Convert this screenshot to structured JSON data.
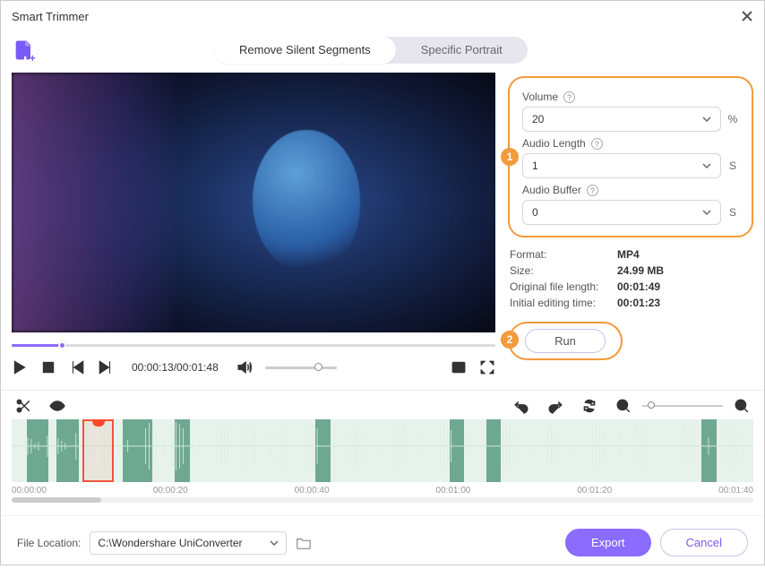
{
  "window": {
    "title": "Smart Trimmer"
  },
  "logo": {
    "name": "app-logo"
  },
  "tabs": [
    {
      "label": "Remove Silent Segments",
      "active": true
    },
    {
      "label": "Specific Portrait",
      "active": false
    }
  ],
  "player": {
    "current_time": "00:00:13",
    "duration": "00:01:48",
    "time_display": "00:00:13/00:01:48"
  },
  "params": {
    "volume": {
      "label": "Volume",
      "value": "20",
      "unit": "%"
    },
    "audio_length": {
      "label": "Audio Length",
      "value": "1",
      "unit": "S"
    },
    "audio_buffer": {
      "label": "Audio Buffer",
      "value": "0",
      "unit": "S"
    }
  },
  "meta": {
    "format": {
      "label": "Format:",
      "value": "MP4"
    },
    "size": {
      "label": "Size:",
      "value": "24.99 MB"
    },
    "orig_len": {
      "label": "Original file length:",
      "value": "00:01:49"
    },
    "init_edit": {
      "label": "Initial editing time:",
      "value": "00:01:23"
    }
  },
  "run": {
    "label": "Run"
  },
  "indicators": {
    "one": "1",
    "two": "2"
  },
  "timeline": {
    "ticks": [
      "00:00:00",
      "00:00:20",
      "00:00:40",
      "00:01:00",
      "00:01:20",
      "00:01:40"
    ]
  },
  "footer": {
    "location_label": "File Location:",
    "location_value": "C:\\Wondershare UniConverter",
    "export": "Export",
    "cancel": "Cancel"
  }
}
